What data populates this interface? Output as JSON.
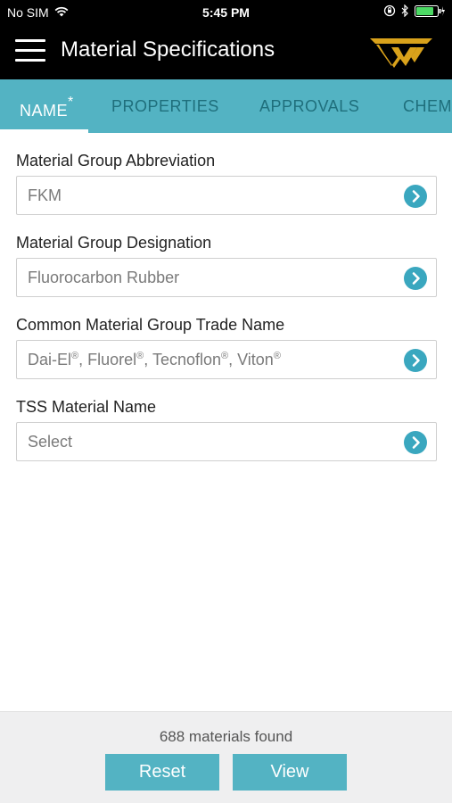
{
  "status_bar": {
    "carrier": "No SIM",
    "time": "5:45 PM"
  },
  "header": {
    "title": "Material Specifications",
    "logo_name": "tss-logo"
  },
  "tabs": [
    {
      "label": "NAME",
      "marker": "*",
      "active": true
    },
    {
      "label": "PROPERTIES",
      "active": false
    },
    {
      "label": "APPROVALS",
      "active": false
    },
    {
      "label": "CHEM",
      "active": false
    }
  ],
  "fields": [
    {
      "label": "Material Group Abbreviation",
      "value": "FKM"
    },
    {
      "label": "Material Group Designation",
      "value": "Fluorocarbon Rubber"
    },
    {
      "label": "Common Material Group Trade Name",
      "value_parts": [
        "Dai-El",
        "®",
        ", Fluorel",
        "®",
        ", Tecnoflon",
        "®",
        ", Viton",
        "®"
      ]
    },
    {
      "label": "TSS Material Name",
      "value": "Select"
    }
  ],
  "footer": {
    "found_text": "688 materials found",
    "reset_label": "Reset",
    "view_label": "View"
  },
  "colors": {
    "accent": "#53b3c3",
    "arrow": "#3aa7bf",
    "header_bg": "#000000",
    "battery": "#4cd964",
    "logo_gold": "#d9a21b"
  }
}
